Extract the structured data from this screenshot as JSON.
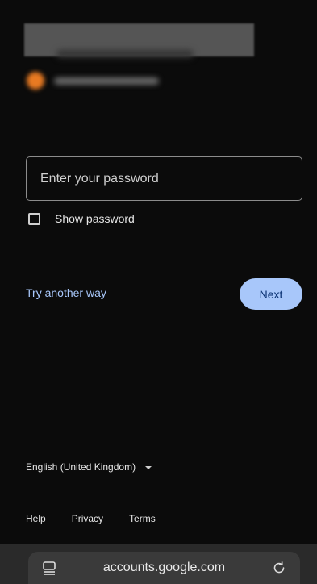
{
  "account": {
    "avatar_color": "#e87a22"
  },
  "password": {
    "placeholder": "Enter your password",
    "value": ""
  },
  "show_password": {
    "label": "Show password",
    "checked": false
  },
  "actions": {
    "try_another_way": "Try another way",
    "next": "Next"
  },
  "language": {
    "selected": "English (United Kingdom)"
  },
  "footer": {
    "links": [
      "Help",
      "Privacy",
      "Terms"
    ]
  },
  "browser": {
    "url": "accounts.google.com",
    "left_icon": "page-tabs-icon",
    "right_icon": "reload-icon"
  },
  "colors": {
    "background": "#0b0b0b",
    "accent": "#a8c7fa",
    "button_text": "#062e6f"
  }
}
